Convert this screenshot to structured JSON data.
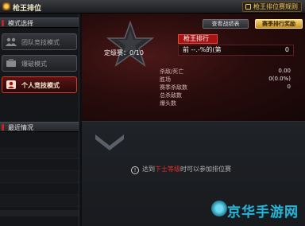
{
  "header": {
    "title": "枪王排位",
    "right_button": "枪王排位赛规则"
  },
  "sidebar": {
    "mode_section_title": "模式选择",
    "modes": [
      {
        "label": "团队竞技模式",
        "active": false
      },
      {
        "label": "爆破模式",
        "active": false
      },
      {
        "label": "个人竞技模式",
        "active": true
      }
    ],
    "record_section_title": "最近情况"
  },
  "main": {
    "detail_button": "查看战绩表",
    "rank_button": "赛季排行奖励",
    "level_label": "定级赛：0/10",
    "rank_tab": "枪王排行",
    "rank_row_left": "前 --.-%的(第",
    "rank_row_right": "0",
    "stats": [
      {
        "label": "杀敌/死亡",
        "value": "0.00"
      },
      {
        "label": "胜场",
        "value": "0(0.0%)"
      },
      {
        "label": "赛季杀敌数",
        "value": "0"
      },
      {
        "label": "总杀敌数",
        "value": ""
      },
      {
        "label": "爆头数",
        "value": ""
      }
    ],
    "notice_prefix": "达到",
    "notice_highlight": "下士等级",
    "notice_suffix": "时可以参加排位赛"
  },
  "watermark": "京华手游网",
  "colors": {
    "accent_red": "#c22222",
    "gold": "#e8c66a",
    "watermark": "#2fb2d2"
  }
}
